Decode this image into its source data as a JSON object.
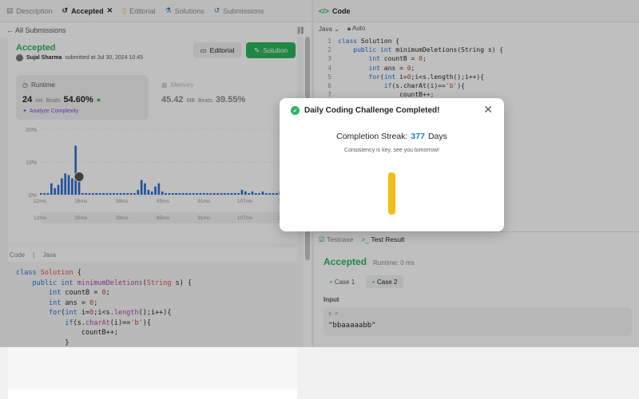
{
  "left_tabs": [
    {
      "label": "Description",
      "active": false
    },
    {
      "label": "Accepted",
      "active": true
    },
    {
      "label": "Editorial",
      "active": false
    },
    {
      "label": "Solutions",
      "active": false
    },
    {
      "label": "Submissions",
      "active": false
    }
  ],
  "back_label": "All Submissions",
  "submission": {
    "status": "Accepted",
    "author": "Sujal Sharma",
    "submitted_text": "submitted at Jul 30, 2024 10:45",
    "editorial_btn": "Editorial",
    "solution_btn": "Solution"
  },
  "runtime": {
    "label": "Runtime",
    "value": "24",
    "unit": "ms",
    "beats_label": "Beats",
    "beats_pct": "54.60%",
    "analyze": "Analyze Complexity"
  },
  "memory": {
    "label": "Memory",
    "value": "45.42",
    "unit": "MB",
    "beats_label": "Beats",
    "beats_pct": "39.55%"
  },
  "chart_data": {
    "type": "bar",
    "y_ticks": [
      "20%",
      "10%",
      "0%"
    ],
    "ylim": [
      0,
      20
    ],
    "x_ticks": [
      "12ms",
      "26ms",
      "39ms",
      "65ms",
      "91ms",
      "107ms",
      "127ms"
    ],
    "values": [
      0.5,
      0.5,
      0.5,
      3.5,
      2,
      3,
      5,
      6.5,
      6,
      5,
      15,
      5.5,
      0.5,
      0.5,
      0.5,
      0.5,
      0.5,
      0.5,
      0.5,
      0.5,
      0.5,
      0.5,
      0.5,
      0.5,
      0.5,
      0.5,
      0.5,
      0.5,
      1.5,
      4.5,
      3.5,
      1.5,
      1,
      2.5,
      3.5,
      1,
      0.5,
      0.5,
      0.5,
      0.5,
      0.5,
      0.5,
      0.5,
      0.5,
      0.5,
      0.5,
      0.5,
      0.5,
      0.5,
      0.5,
      0.5,
      0.5,
      0.5,
      0.5,
      0.5,
      0.5,
      0.5,
      0.5,
      1.5,
      1,
      0.5,
      1,
      0.5,
      0.5,
      1,
      0.5,
      0.5,
      0.5,
      0.5,
      1,
      1.5
    ],
    "highlight_index": 11,
    "color": "#2f6fd1"
  },
  "code_panel": {
    "tab": "Code",
    "lang": "Java",
    "lines": [
      "class Solution {",
      "    public int minimumDeletions(String s) {",
      "        int countB = 0;",
      "        int ans = 0;",
      "        for(int i=0;i<s.length();i++){",
      "            if(s.charAt(i)=='b'){",
      "                countB++;",
      "            }"
    ]
  },
  "editor": {
    "title": "Code",
    "lang": "Java",
    "mode": "Auto",
    "lines": [
      "class Solution {",
      "    public int minimumDeletions(String s) {",
      "        int countB = 0;",
      "        int ans = 0;",
      "        for(int i=0;i<s.length();i++){",
      "            if(s.charAt(i)=='b'){",
      "                countB++;"
    ]
  },
  "bottom": {
    "testcase_tab": "Testcase",
    "result_tab": "Test Result",
    "status": "Accepted",
    "runtime": "Runtime: 0 ms",
    "cases": [
      "Case 1",
      "Case 2"
    ],
    "input_label": "Input",
    "var_name": "s =",
    "input_value": "\"bbaaaaabb\""
  },
  "modal": {
    "title": "Daily Coding Challenge Completed!",
    "streak_label": "Completion Streak:",
    "streak_num": "377",
    "streak_unit": "Days",
    "subtitle": "Consistency is key, see you tomorrow!"
  }
}
